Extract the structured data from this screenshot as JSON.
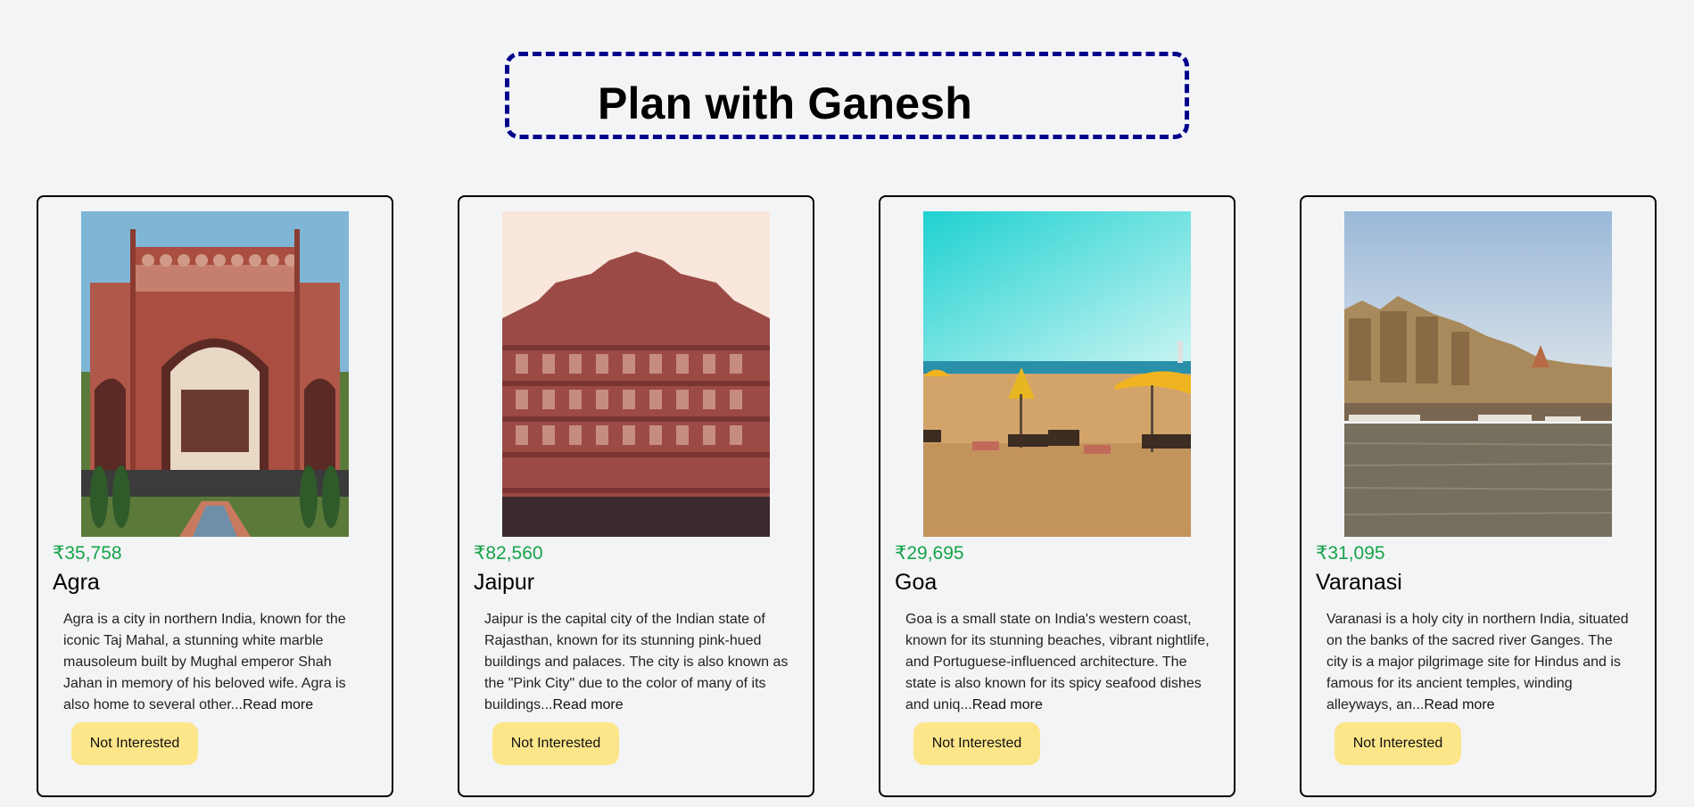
{
  "header": {
    "title": "Plan with Ganesh"
  },
  "cards": [
    {
      "price": "₹35,758",
      "city": "Agra",
      "description": "Agra is a city in northern India, known for the iconic Taj Mahal, a stunning white marble mausoleum built by Mughal emperor Shah Jahan in memory of his beloved wife. Agra is also home to several other...",
      "read_more": "Read more",
      "button": "Not Interested",
      "image": "agra-gateway-photo"
    },
    {
      "price": "₹82,560",
      "city": "Jaipur",
      "description": "Jaipur is the capital city of the Indian state of Rajasthan, known for its stunning pink-hued buildings and palaces. The city is also known as the \"Pink City\" due to the color of many of its buildings...",
      "read_more": "Read more",
      "button": "Not Interested",
      "image": "hawa-mahal-photo"
    },
    {
      "price": "₹29,695",
      "city": "Goa",
      "description": "Goa is a small state on India's western coast, known for its stunning beaches, vibrant nightlife, and Portuguese-influenced architecture. The state is also known for its spicy seafood dishes and uniq...",
      "read_more": "Read more",
      "button": "Not Interested",
      "image": "goa-beach-photo"
    },
    {
      "price": "₹31,095",
      "city": "Varanasi",
      "description": "Varanasi is a holy city in northern India, situated on the banks of the sacred river Ganges. The city is a major pilgrimage site for Hindus and is famous for its ancient temples, winding alleyways, an...",
      "read_more": "Read more",
      "button": "Not Interested",
      "image": "varanasi-ghats-photo"
    }
  ],
  "colors": {
    "price": "#16a34a",
    "button_bg": "#fde68a",
    "title_border": "#00008b",
    "page_bg": "#f3f4f6"
  }
}
